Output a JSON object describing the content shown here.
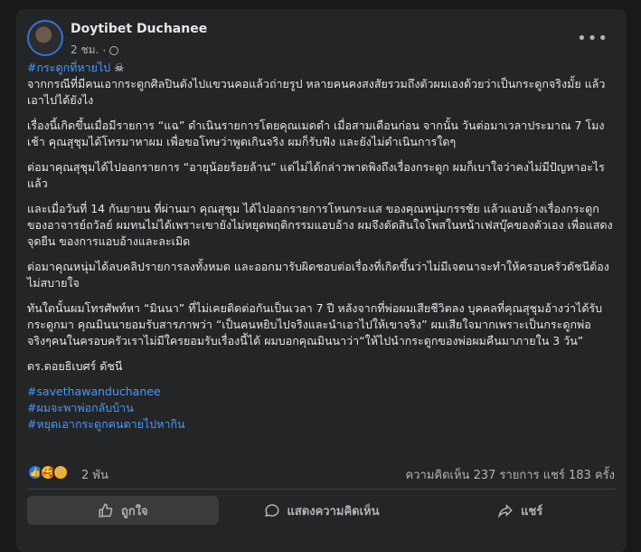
{
  "post": {
    "author": "Doytibet Duchanee",
    "time": "2 ชม.",
    "dot": "·",
    "hashtag_top": "#กระดูกที่หายไป",
    "skull": "☠",
    "paragraphs": [
      "จากกรณีที่มีคนเอากระดูกศิลปินดังไปแขวนคอแล้วถ่ายรูป หลายคนคงสงสัยรวมถึงตัวผมเองด้วยว่าเป็นกระดูกจริงมั้ย แล้วเอาไปได้ยังไง",
      "เรื่องนี้เกิดขึ้นเมื่อมีรายการ “แฉ” ดำเนินรายการโดยคุณเมดดำ เมื่อสามเดือนก่อน จากนั้น วันต่อมาเวลาประมาณ 7 โมงเช้า คุณสุชุมได้โทรมาหาผม เพื่อขอโทษว่าพูดเกินจริง ผมก็รับฟัง และยังไม่ดำเนินการใดๆ",
      "ต่อมาคุณสุชุมได้ไปออกรายการ “อายุน้อยร้อยล้าน” แต่ไม่ได้กล่าวพาดพิงถึงเรื่องกระดูก ผมก็เบาใจว่าคงไม่มีปัญหาอะไรแล้ว",
      "และเมื่อวันที่ 14 กันยายน ที่ผ่านมา คุณสุชุม ได้ไปออกรายการโหนกระแส ของคุณหนุ่มกรรชัย แล้วแอบอ้างเรื่องกระดูกของอาจารย์ถวัลย์ ผมทนไม่ได้เพราะเขายังไม่หยุดพฤติกรรมแอบอ้าง ผมจึงตัดสินใจโพสในหน้าเฟสบุ๊คของตัวเอง เพื่อแสดงจุดยืน ของการแอบอ้างและละเมิด",
      "ต่อมาคุณหนุ่มได้ลบคลิปรายการลงทั้งหมด และออกมารับผิดชอบต่อเรื่องที่เกิดขึ้นว่าไม่มีเจตนาจะทำให้ครอบครัวดัชนีต้องไม่สบายใจ",
      "ทันใดนั้นผมโทรศัพท์หา “มินนา” ที่ไม่เคยติดต่อกันเป็นเวลา 7 ปี หลังจากที่พ่อผมเสียชีวิตลง บุคคลที่คุณสุชุมอ้างว่าได้รับกระดูกมา คุณมินนายอมรับสารภาพว่า “เป็นคนหยิบไปจริงและนำเอาไปให้เขาจริง” ผมเสียใจมากเพราะเป็นกระดูกพ่อจริงๆคนในครอบครัวเราไม่มีใครยอมรับเรื่องนี้ได้ ผมบอกคุณมินนาว่า“ให้ไปนำกระดูกของพ่อผมคืนมาภายใน 3 วัน”"
    ],
    "signature": "ดร.ดอยธิเบศร์ ดัชนี",
    "tags": [
      "#savethawanduchanee",
      "#ผมจะพาพ่อกลับบ้าน",
      "#หยุดเอากระดูกคนตายไปหากิน"
    ]
  },
  "stats": {
    "reactions": "2 พัน",
    "comments_shares": "ความคิดเห็น 237 รายการ  แชร์ 183 ครั้ง"
  },
  "actions": {
    "like": "ถูกใจ",
    "comment": "แสดงความคิดเห็น",
    "share": "แชร์"
  },
  "colors": {
    "background": "#18191a",
    "card": "#242526",
    "link": "#4599ff",
    "like_blue": "#2078f4"
  }
}
